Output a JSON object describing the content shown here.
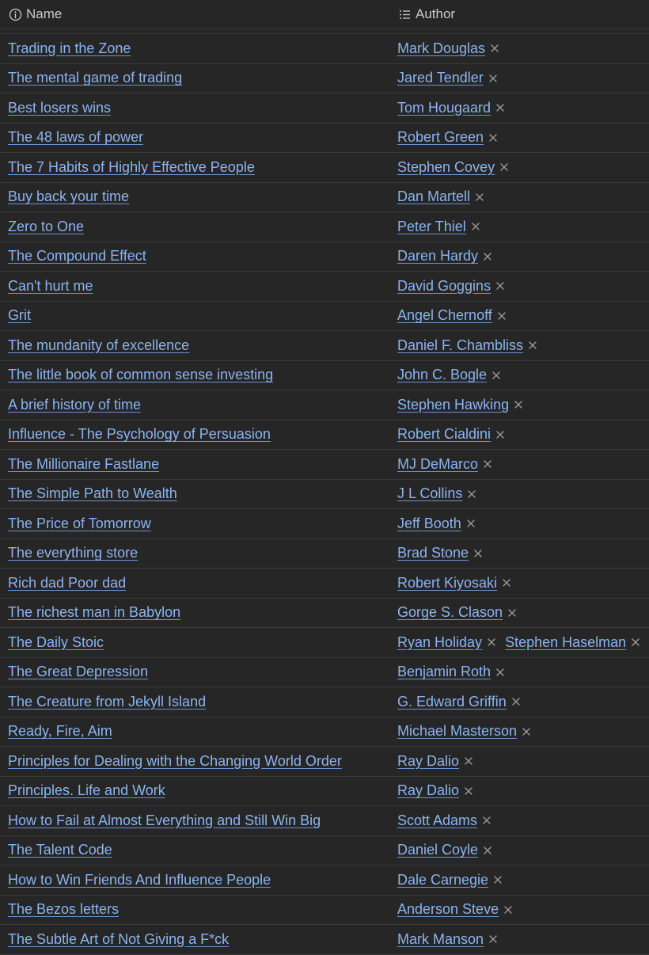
{
  "header": {
    "name_label": "Name",
    "author_label": "Author"
  },
  "colors": {
    "background": "#262626",
    "link": "#8ab4f0",
    "divider": "#3a3a3a",
    "header_text": "#c8c8c8",
    "remove_icon": "#9a9a9a"
  },
  "icons": {
    "name_column": "info-circle-icon",
    "author_column": "list-icon",
    "remove": "close-icon"
  },
  "rows": [
    {
      "name": "Trading in the Zone",
      "authors": [
        "Mark Douglas"
      ]
    },
    {
      "name": "The mental game of trading",
      "authors": [
        "Jared Tendler"
      ]
    },
    {
      "name": "Best losers wins",
      "authors": [
        "Tom Hougaard"
      ]
    },
    {
      "name": "The 48 laws of power",
      "authors": [
        "Robert Green"
      ]
    },
    {
      "name": "The 7 Habits of Highly Effective People",
      "authors": [
        "Stephen Covey"
      ]
    },
    {
      "name": "Buy back your time",
      "authors": [
        "Dan Martell"
      ]
    },
    {
      "name": "Zero to One",
      "authors": [
        "Peter Thiel"
      ]
    },
    {
      "name": "The Compound Effect",
      "authors": [
        "Daren Hardy"
      ]
    },
    {
      "name": "Can't hurt me",
      "authors": [
        "David Goggins"
      ]
    },
    {
      "name": "Grit",
      "authors": [
        "Angel Chernoff"
      ]
    },
    {
      "name": "The mundanity of excellence",
      "authors": [
        "Daniel F. Chambliss"
      ]
    },
    {
      "name": "The little book of common sense investing",
      "authors": [
        "John C. Bogle"
      ]
    },
    {
      "name": "A brief history of time",
      "authors": [
        "Stephen Hawking"
      ]
    },
    {
      "name": "Influence - The Psychology of Persuasion",
      "authors": [
        "Robert Cialdini"
      ]
    },
    {
      "name": "The Millionaire Fastlane",
      "authors": [
        "MJ DeMarco"
      ]
    },
    {
      "name": "The Simple Path to Wealth",
      "authors": [
        "J L Collins"
      ]
    },
    {
      "name": "The Price of Tomorrow",
      "authors": [
        "Jeff Booth"
      ]
    },
    {
      "name": "The everything store",
      "authors": [
        "Brad Stone"
      ]
    },
    {
      "name": "Rich dad Poor dad",
      "authors": [
        "Robert Kiyosaki"
      ]
    },
    {
      "name": "The richest man in Babylon",
      "authors": [
        "Gorge S. Clason"
      ]
    },
    {
      "name": "The Daily Stoic",
      "authors": [
        "Ryan Holiday",
        "Stephen Haselman"
      ]
    },
    {
      "name": "The Great Depression",
      "authors": [
        "Benjamin Roth"
      ]
    },
    {
      "name": "The Creature from Jekyll Island",
      "authors": [
        "G. Edward Griffin"
      ]
    },
    {
      "name": "Ready, Fire, Aim",
      "authors": [
        "Michael Masterson"
      ]
    },
    {
      "name": "Principles for Dealing with the Changing World Order",
      "authors": [
        "Ray Dalio"
      ]
    },
    {
      "name": "Principles. Life and Work",
      "authors": [
        "Ray Dalio"
      ]
    },
    {
      "name": "How to Fail at Almost Everything and Still Win Big",
      "authors": [
        "Scott Adams"
      ]
    },
    {
      "name": "The Talent Code",
      "authors": [
        "Daniel Coyle"
      ]
    },
    {
      "name": "How to Win Friends And Influence People",
      "authors": [
        "Dale Carnegie"
      ]
    },
    {
      "name": "The Bezos letters",
      "authors": [
        "Anderson Steve"
      ]
    },
    {
      "name": "The Subtle Art of Not Giving a F*ck",
      "authors": [
        "Mark Manson"
      ]
    }
  ]
}
